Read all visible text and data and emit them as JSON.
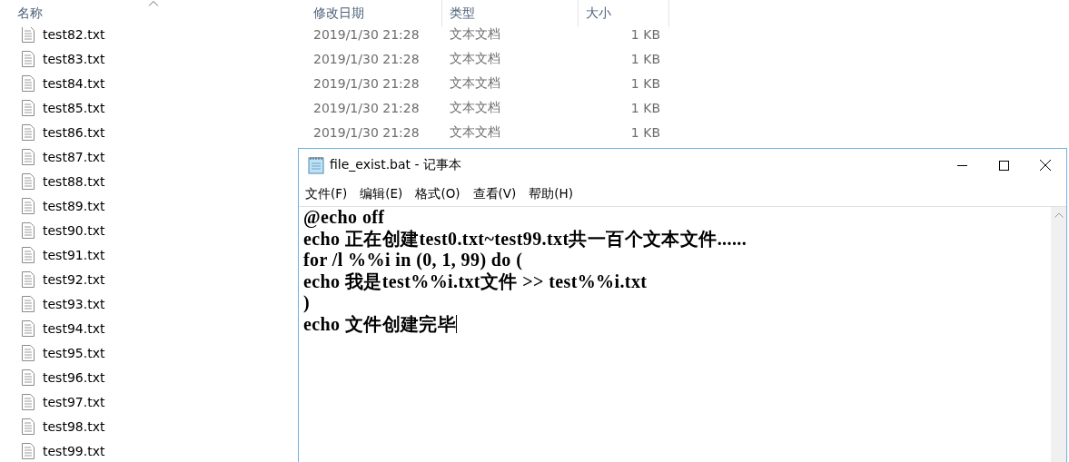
{
  "explorer": {
    "columns": [
      {
        "label": "名称",
        "sorted": true
      },
      {
        "label": "修改日期",
        "sorted": false
      },
      {
        "label": "类型",
        "sorted": false
      },
      {
        "label": "大小",
        "sorted": false
      }
    ],
    "rows": [
      {
        "name": "test82.txt",
        "date": "2019/1/30 21:28",
        "type": "文本文档",
        "size": "1 KB"
      },
      {
        "name": "test83.txt",
        "date": "2019/1/30 21:28",
        "type": "文本文档",
        "size": "1 KB"
      },
      {
        "name": "test84.txt",
        "date": "2019/1/30 21:28",
        "type": "文本文档",
        "size": "1 KB"
      },
      {
        "name": "test85.txt",
        "date": "2019/1/30 21:28",
        "type": "文本文档",
        "size": "1 KB"
      },
      {
        "name": "test86.txt",
        "date": "2019/1/30 21:28",
        "type": "文本文档",
        "size": "1 KB"
      },
      {
        "name": "test87.txt"
      },
      {
        "name": "test88.txt"
      },
      {
        "name": "test89.txt"
      },
      {
        "name": "test90.txt"
      },
      {
        "name": "test91.txt"
      },
      {
        "name": "test92.txt"
      },
      {
        "name": "test93.txt"
      },
      {
        "name": "test94.txt"
      },
      {
        "name": "test95.txt"
      },
      {
        "name": "test96.txt"
      },
      {
        "name": "test97.txt"
      },
      {
        "name": "test98.txt"
      },
      {
        "name": "test99.txt"
      }
    ]
  },
  "notepad": {
    "title": "file_exist.bat - 记事本",
    "menu": [
      "文件(F)",
      "编辑(E)",
      "格式(O)",
      "查看(V)",
      "帮助(H)"
    ],
    "lines": [
      "@echo off",
      "echo 正在创建test0.txt~test99.txt共一百个文本文件......",
      "for /l %%i in (0, 1, 99) do (",
      "echo 我是test%%i.txt文件 >> test%%i.txt",
      ")",
      "echo 文件创建完毕"
    ]
  }
}
